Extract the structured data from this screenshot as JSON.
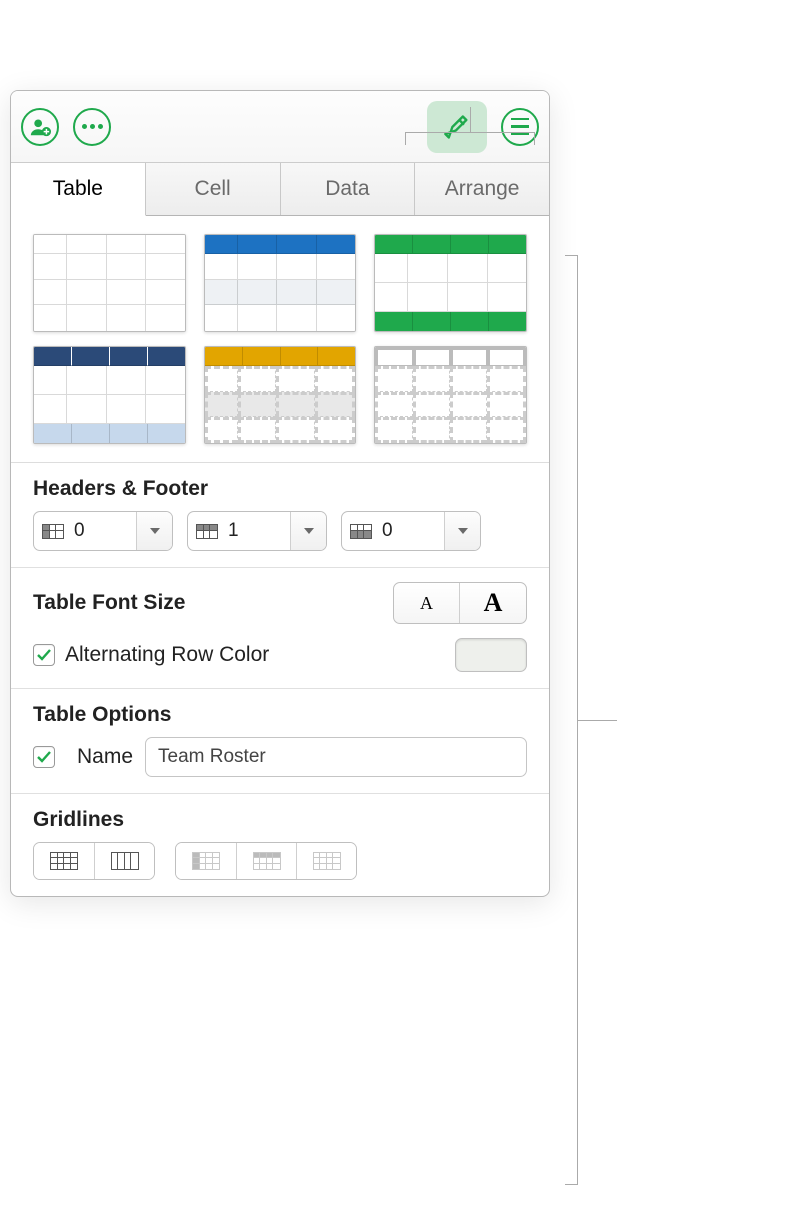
{
  "toolbar": {
    "collaborate_icon": "add-user-icon",
    "more_icon": "more-options-icon",
    "format_icon": "format-brush-icon",
    "sidebar_icon": "sidebar-toggle-icon"
  },
  "tabs": {
    "items": [
      "Table",
      "Cell",
      "Data",
      "Arrange"
    ],
    "active_index": 0
  },
  "table_styles": {
    "count": 6
  },
  "headers_footer": {
    "title": "Headers & Footer",
    "header_columns": "0",
    "header_rows": "1",
    "footer_rows": "0"
  },
  "font_size": {
    "title": "Table Font Size",
    "small_label": "A",
    "large_label": "A"
  },
  "alternating": {
    "label": "Alternating Row Color",
    "checked": true,
    "color": "#eef0ec"
  },
  "table_options": {
    "title": "Table Options",
    "name_label": "Name",
    "name_checked": true,
    "name_value": "Team Roster"
  },
  "gridlines": {
    "title": "Gridlines"
  },
  "colors": {
    "accent": "#1fa94c"
  }
}
